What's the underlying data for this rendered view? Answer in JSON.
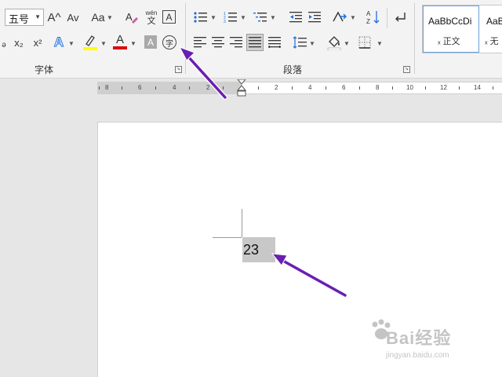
{
  "ribbon": {
    "font_size": "五号",
    "grow_font_icon": "A^",
    "shrink_font_icon": "Av",
    "change_case_icon": "Aa",
    "phonetic_top": "wén",
    "phonetic_bottom": "文",
    "char_border_icon": "A",
    "subscript": "x₂",
    "superscript": "x²",
    "text_effect_icon": "A",
    "font_color_icon": "A",
    "char_shading_icon": "A",
    "enclose_icon": "字",
    "font_group_label": "字体",
    "paragraph_group_label": "段落",
    "styles": [
      {
        "sample": "AaBbCcDi",
        "name": "ₓ 正文"
      },
      {
        "sample": "AaB",
        "name": "ₓ 无"
      }
    ],
    "colors": {
      "highlight": "#ffff00",
      "font_color": "#e00000",
      "accent": "#1e6fd9"
    }
  },
  "ruler": {
    "left_numbers": [
      "8",
      "6",
      "4",
      "2"
    ],
    "right_numbers": [
      "2",
      "4",
      "6",
      "8",
      "10",
      "12",
      "14"
    ]
  },
  "document": {
    "selected_text": "23"
  },
  "annotation": {
    "arrow_color": "#6a1fb0"
  },
  "watermark": {
    "logo": "Bai经验",
    "url": "jingyan.baidu.com"
  }
}
